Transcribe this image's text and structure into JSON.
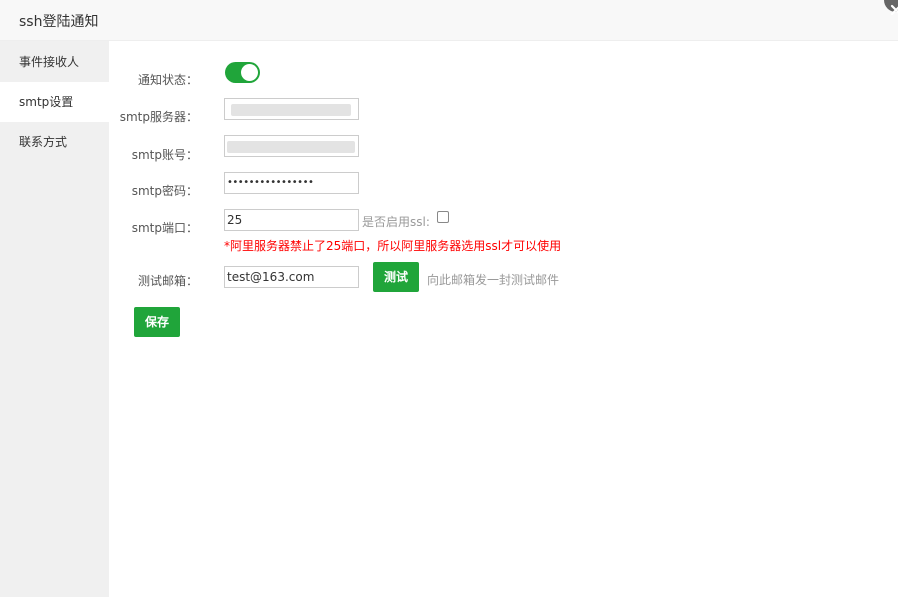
{
  "dialog": {
    "title": "ssh登陆通知"
  },
  "sidebar": {
    "items": [
      {
        "label": "事件接收人",
        "active": false
      },
      {
        "label": "smtp设置",
        "active": true
      },
      {
        "label": "联系方式",
        "active": false
      }
    ]
  },
  "form": {
    "notify_status": {
      "label": "通知状态：",
      "enabled": true
    },
    "smtp_server": {
      "label": "smtp服务器：",
      "value": ""
    },
    "smtp_account": {
      "label": "smtp账号：",
      "value": ""
    },
    "smtp_password": {
      "label": "smtp密码：",
      "value": "••••••••••••••••"
    },
    "smtp_port": {
      "label": "smtp端口：",
      "value": "25"
    },
    "ssl": {
      "label": "是否启用ssl:",
      "checked": false
    },
    "warning": "*阿里服务器禁止了25端口，所以阿里服务器选用ssl才可以使用",
    "test_email": {
      "label": "测试邮箱：",
      "value": "test@163.com"
    },
    "test_button": "测试",
    "test_hint": "向此邮箱发一封测试邮件",
    "save_button": "保存"
  },
  "colors": {
    "accent": "#20a53a",
    "warning": "#ff0000",
    "sidebar_bg": "#f0f0f0"
  },
  "icons": {
    "close": "close-icon"
  }
}
